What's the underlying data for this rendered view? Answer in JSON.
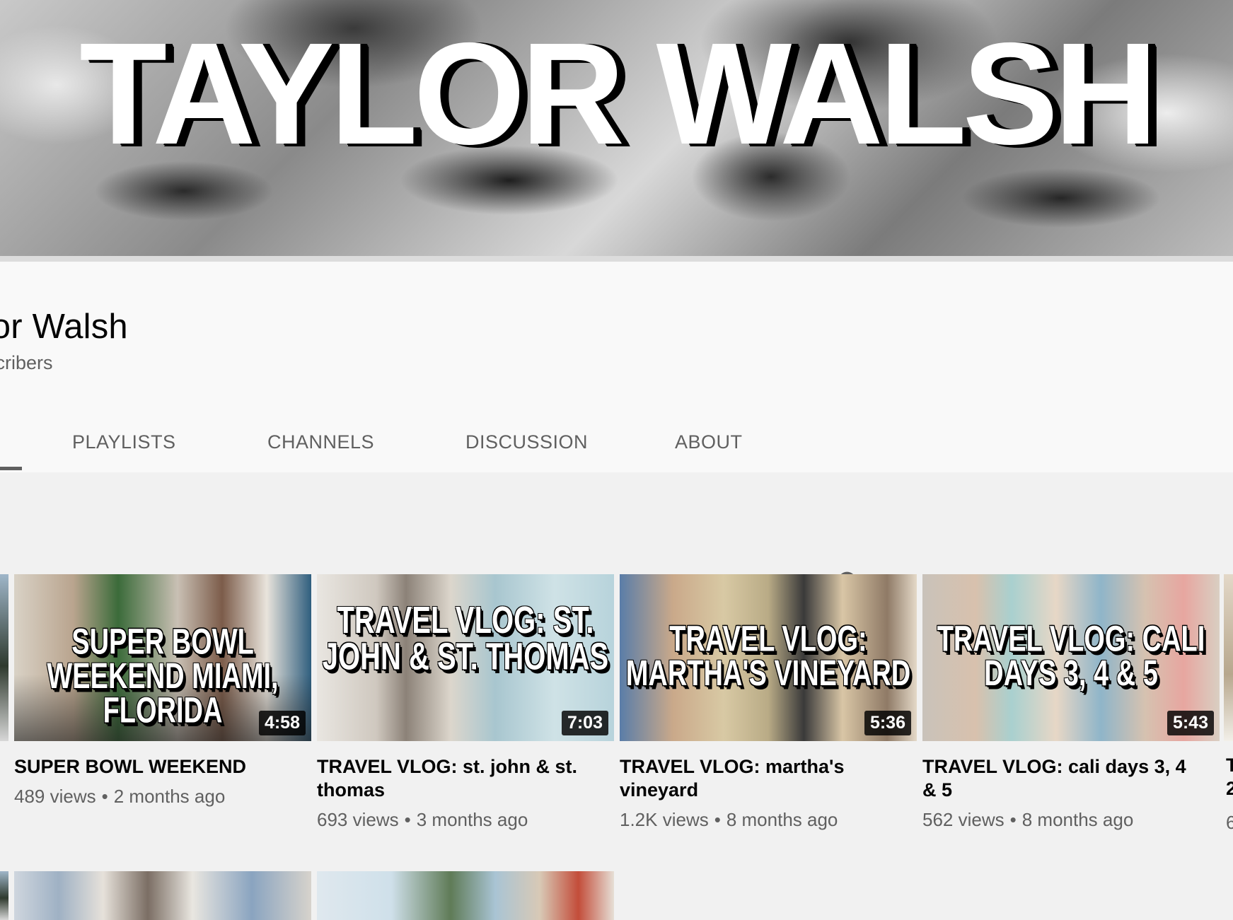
{
  "banner": {
    "title": "TAYLOR WALSH"
  },
  "channel": {
    "name": "ylor Walsh",
    "subscribers": "ubscribers"
  },
  "tabs": [
    {
      "label": "PLAYLISTS"
    },
    {
      "label": "CHANNELS"
    },
    {
      "label": "DISCUSSION"
    },
    {
      "label": "ABOUT"
    }
  ],
  "videos": [
    {
      "thumb_text": "SUPER BOWL WEEKEND MIAMI, FLORIDA",
      "duration": "4:58",
      "title": "SUPER BOWL WEEKEND",
      "views": "489 views",
      "age": "2 months ago"
    },
    {
      "thumb_text": "TRAVEL VLOG: ST. JOHN & ST. THOMAS",
      "duration": "7:03",
      "title": "TRAVEL VLOG: st. john & st. thomas",
      "views": "693 views",
      "age": "3 months ago"
    },
    {
      "thumb_text": "TRAVEL VLOG: MARTHA'S VINEYARD",
      "duration": "5:36",
      "title": "TRAVEL VLOG: martha's vineyard",
      "views": "1.2K views",
      "age": "8 months ago"
    },
    {
      "thumb_text": "TRAVEL VLOG: CALI DAYS 3, 4 & 5",
      "duration": "5:43",
      "title": "TRAVEL VLOG: cali days 3, 4 & 5",
      "views": "562 views",
      "age": "8 months ago"
    }
  ],
  "partial_right": {
    "title_line1": "T",
    "title_line2": "2",
    "meta": "6"
  },
  "meta_separator": "•",
  "icons": {
    "search": "search-icon"
  }
}
